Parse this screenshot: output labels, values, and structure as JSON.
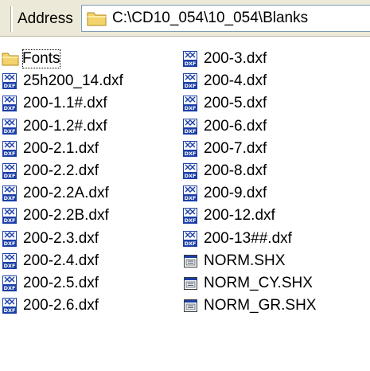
{
  "address": {
    "label": "Address",
    "path": "C:\\CD10_054\\10_054\\Blanks"
  },
  "files": {
    "column1": [
      {
        "name": "Fonts",
        "icon": "folder-icon",
        "focused": true
      },
      {
        "name": "25h200_14.dxf",
        "icon": "dxf-file-icon"
      },
      {
        "name": "200-1.1#.dxf",
        "icon": "dxf-file-icon"
      },
      {
        "name": "200-1.2#.dxf",
        "icon": "dxf-file-icon"
      },
      {
        "name": "200-2.1.dxf",
        "icon": "dxf-file-icon"
      },
      {
        "name": "200-2.2.dxf",
        "icon": "dxf-file-icon"
      },
      {
        "name": "200-2.2A.dxf",
        "icon": "dxf-file-icon"
      },
      {
        "name": "200-2.2B.dxf",
        "icon": "dxf-file-icon"
      },
      {
        "name": "200-2.3.dxf",
        "icon": "dxf-file-icon"
      },
      {
        "name": "200-2.4.dxf",
        "icon": "dxf-file-icon"
      },
      {
        "name": "200-2.5.dxf",
        "icon": "dxf-file-icon"
      },
      {
        "name": "200-2.6.dxf",
        "icon": "dxf-file-icon"
      }
    ],
    "column2": [
      {
        "name": "200-3.dxf",
        "icon": "dxf-file-icon"
      },
      {
        "name": "200-4.dxf",
        "icon": "dxf-file-icon"
      },
      {
        "name": "200-5.dxf",
        "icon": "dxf-file-icon"
      },
      {
        "name": "200-6.dxf",
        "icon": "dxf-file-icon"
      },
      {
        "name": "200-7.dxf",
        "icon": "dxf-file-icon"
      },
      {
        "name": "200-8.dxf",
        "icon": "dxf-file-icon"
      },
      {
        "name": "200-9.dxf",
        "icon": "dxf-file-icon"
      },
      {
        "name": "200-12.dxf",
        "icon": "dxf-file-icon"
      },
      {
        "name": "200-13##.dxf",
        "icon": "dxf-file-icon"
      },
      {
        "name": "NORM.SHX",
        "icon": "shx-file-icon"
      },
      {
        "name": "NORM_CY.SHX",
        "icon": "shx-file-icon"
      },
      {
        "name": "NORM_GR.SHX",
        "icon": "shx-file-icon"
      }
    ]
  },
  "colors": {
    "toolbar_bg": "#ece9d8",
    "folder_yellow": "#f3d36b",
    "dxf_blue": "#1b3fa8"
  }
}
